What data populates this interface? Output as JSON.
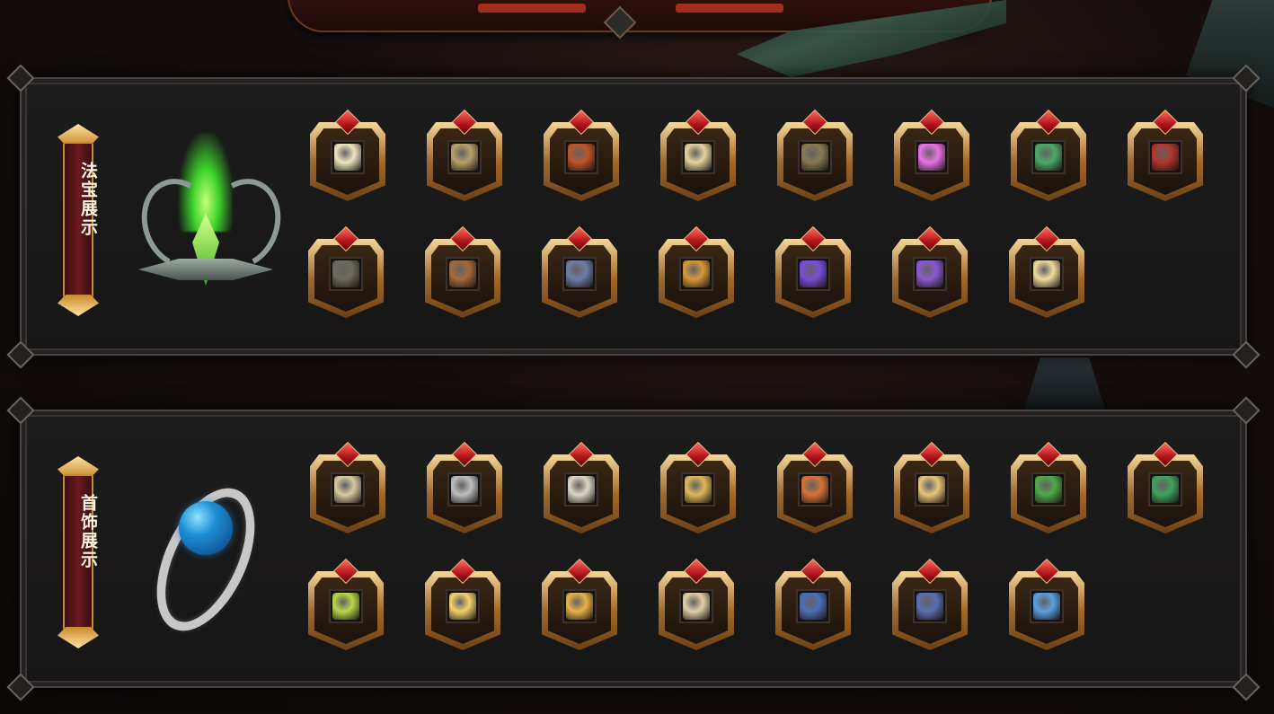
{
  "sections": [
    {
      "title": "法宝展示",
      "hero_icon": "green-emblem-icon",
      "items": [
        {
          "icon": "jade-disc-icon",
          "color": "#f1e6c0"
        },
        {
          "icon": "scroll-bundle-icon",
          "color": "#b9a06a"
        },
        {
          "icon": "red-dagger-icon",
          "color": "#c0552a"
        },
        {
          "icon": "paper-scroll-icon",
          "color": "#e6d3a0"
        },
        {
          "icon": "tablet-icon",
          "color": "#8a7a55"
        },
        {
          "icon": "pink-crystal-icon",
          "color": "#e873e8"
        },
        {
          "icon": "green-sword-icon",
          "color": "#4caa6a"
        },
        {
          "icon": "red-box-icon",
          "color": "#b3362d"
        },
        {
          "icon": "stone-slab-icon",
          "color": "#6e6a5e"
        },
        {
          "icon": "bamboo-slips-icon",
          "color": "#a66a3c"
        },
        {
          "icon": "blue-book-icon",
          "color": "#6d7ea8"
        },
        {
          "icon": "golden-shell-icon",
          "color": "#d89a3c"
        },
        {
          "icon": "purple-orb-icon",
          "color": "#7a4ed8"
        },
        {
          "icon": "purple-book-icon",
          "color": "#8a5bd1"
        },
        {
          "icon": "golden-bowl-icon",
          "color": "#f0dba0"
        }
      ]
    },
    {
      "title": "首饰展示",
      "hero_icon": "blue-orb-ring-icon",
      "items": [
        {
          "icon": "pearl-necklace-icon",
          "color": "#d8c9a5"
        },
        {
          "icon": "silver-brooch-icon",
          "color": "#bfbfbf"
        },
        {
          "icon": "bone-hand-icon",
          "color": "#ddd6c4"
        },
        {
          "icon": "gold-chain-icon",
          "color": "#e0b85a"
        },
        {
          "icon": "gem-ring-icon",
          "color": "#d6743a"
        },
        {
          "icon": "diamond-ring-icon",
          "color": "#e6c47a"
        },
        {
          "icon": "jade-charm-icon",
          "color": "#4ea84a"
        },
        {
          "icon": "green-red-pendant-icon",
          "color": "#3fa260"
        },
        {
          "icon": "green-amulet-icon",
          "color": "#b8d84a"
        },
        {
          "icon": "sun-medal-icon",
          "color": "#f2d36a"
        },
        {
          "icon": "jeweled-shield-icon",
          "color": "#e8b34a"
        },
        {
          "icon": "jeweled-bracelet-icon",
          "color": "#e0cfa8"
        },
        {
          "icon": "blue-gem-bracer-icon",
          "color": "#4d6fb8"
        },
        {
          "icon": "red-gem-bracer-icon",
          "color": "#5b6fb0"
        },
        {
          "icon": "blue-crystal-bracer-icon",
          "color": "#5aa0e0"
        }
      ]
    }
  ]
}
